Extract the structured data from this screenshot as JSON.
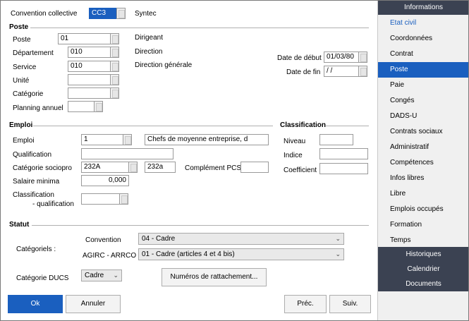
{
  "convention": {
    "label": "Convention collective",
    "code": "CC3",
    "name": "Syntec"
  },
  "poste": {
    "title": "Poste",
    "poste_label": "Poste",
    "poste_value": "01",
    "poste_desc": "Dirigeant",
    "departement_label": "Département",
    "departement_value": "010",
    "departement_desc": "Direction",
    "service_label": "Service",
    "service_value": "010",
    "service_desc": "Direction générale",
    "unite_label": "Unité",
    "unite_value": "",
    "categorie_label": "Catégorie",
    "categorie_value": "",
    "planning_label": "Planning annuel",
    "planning_value": "",
    "date_debut_label": "Date de début",
    "date_debut_value": "01/03/80",
    "date_fin_label": "Date de fin",
    "date_fin_value": " /  /"
  },
  "emploi": {
    "title": "Emploi",
    "emploi_label": "Emploi",
    "emploi_code": "1",
    "emploi_desc": "Chefs de moyenne entreprise, d",
    "qualification_label": "Qualification",
    "qualification_value": "",
    "csp_label": "Catégorie sociopro",
    "csp_value": "232A",
    "csp_code2": "232a",
    "pcs_label": "Complément PCS",
    "pcs_value": "",
    "salaire_label": "Salaire minima",
    "salaire_value": "0,000",
    "classif_label_1": "Classification",
    "classif_label_2": "- qualification",
    "classif_value": ""
  },
  "classification": {
    "title": "Classification",
    "niveau_label": "Niveau",
    "niveau_value": "",
    "indice_label": "Indice",
    "indice_value": "",
    "coefficient_label": "Coefficient",
    "coefficient_value": ""
  },
  "statut": {
    "title": "Statut",
    "categoriels_label": "Catégoriels :",
    "convention_label": "Convention",
    "convention_value": "04 - Cadre",
    "agirc_label": "AGIRC - ARRCO",
    "agirc_value": "01 - Cadre (articles 4 et 4 bis)",
    "ducs_label": "Catégorie DUCS",
    "ducs_value": "Cadre",
    "rattachement_button": "Numéros de rattachement..."
  },
  "footer": {
    "ok": "Ok",
    "annuler": "Annuler",
    "prec": "Préc.",
    "suiv": "Suiv."
  },
  "sidebar": {
    "header": "Informations",
    "items": [
      {
        "label": "Etat civil"
      },
      {
        "label": "Coordonnées"
      },
      {
        "label": "Contrat"
      },
      {
        "label": "Poste"
      },
      {
        "label": "Paie"
      },
      {
        "label": "Congés"
      },
      {
        "label": "DADS-U"
      },
      {
        "label": "Contrats sociaux"
      },
      {
        "label": "Administratif"
      },
      {
        "label": "Compétences"
      },
      {
        "label": "Infos libres"
      },
      {
        "label": "Libre"
      },
      {
        "label": "Emplois occupés"
      },
      {
        "label": "Formation"
      },
      {
        "label": "Temps"
      }
    ],
    "footer_items": [
      {
        "label": "Historiques"
      },
      {
        "label": "Calendrier"
      },
      {
        "label": "Documents"
      }
    ]
  },
  "colors": {
    "accent": "#1a5fbf",
    "dark_header": "#3b4252"
  }
}
